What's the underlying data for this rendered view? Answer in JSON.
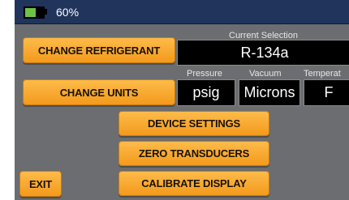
{
  "status": {
    "battery_percent": 60,
    "battery_text": "60%"
  },
  "buttons": {
    "change_refrigerant": "CHANGE REFRIGERANT",
    "change_units": "CHANGE UNITS",
    "device_settings": "DEVICE SETTINGS",
    "zero_transducers": "ZERO TRANSDUCERS",
    "calibrate_display": "CALIBRATE DISPLAY",
    "exit": "EXIT"
  },
  "current_selection": {
    "label": "Current Selection",
    "value": "R-134a"
  },
  "units": {
    "pressure_label": "Pressure",
    "pressure_value": "psig",
    "vacuum_label": "Vacuum",
    "vacuum_value": "Microns",
    "temperature_label": "Temperat",
    "temperature_value": "F"
  },
  "colors": {
    "button": "#f7a52c",
    "status_bar": "#20345c",
    "background": "#6b6d70",
    "battery": "#6ec345"
  }
}
